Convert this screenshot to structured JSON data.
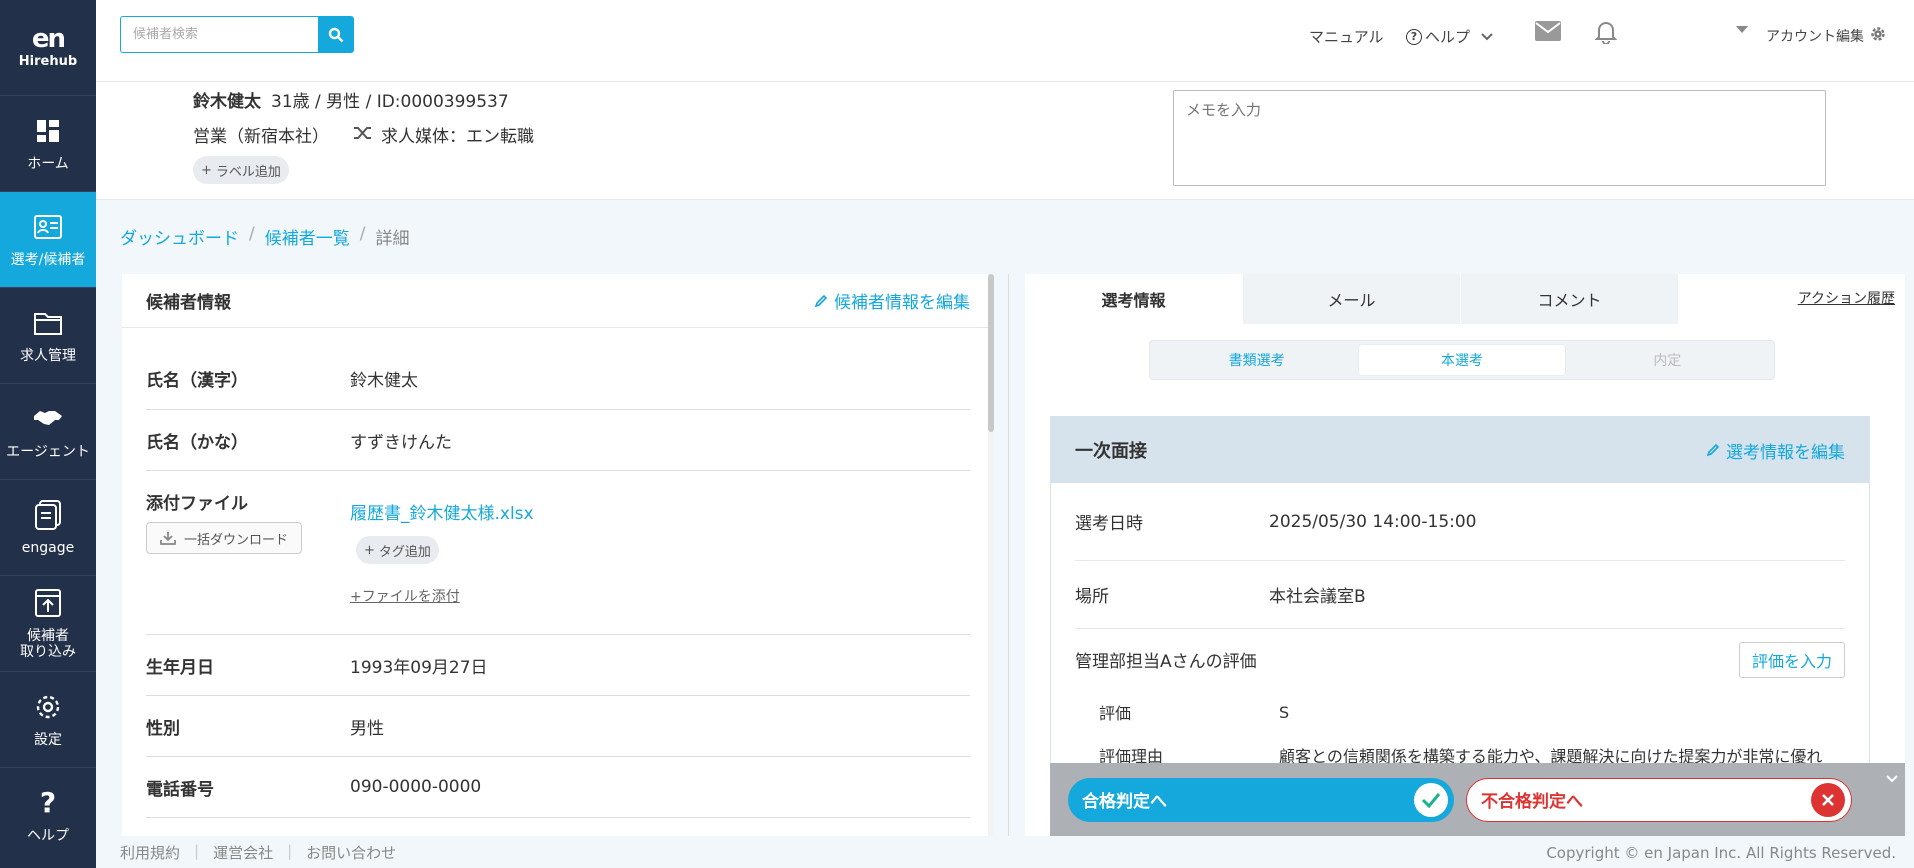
{
  "sidebar": {
    "logo_mark": "en",
    "logo_text": "Hirehub",
    "items": [
      {
        "label": "ホーム",
        "icon": "dashboard-icon"
      },
      {
        "label": "選考/候補者",
        "icon": "id-card-icon"
      },
      {
        "label": "求人管理",
        "icon": "folder-icon"
      },
      {
        "label": "エージェント",
        "icon": "handshake-icon"
      },
      {
        "label": "engage",
        "icon": "engage-icon"
      },
      {
        "label1": "候補者",
        "label2": "取り込み",
        "icon": "import-icon"
      },
      {
        "label": "設定",
        "icon": "gear-icon"
      },
      {
        "label": "ヘルプ",
        "icon": "question-icon"
      }
    ]
  },
  "header": {
    "search_placeholder": "候補者検索",
    "manual": "マニュアル",
    "help": "ヘルプ",
    "account": "アカウント編集"
  },
  "profile": {
    "name": "鈴木健太",
    "meta": "31歳 / 男性 / ID:0000399537",
    "dept": "営業（新宿本社）",
    "media": "求人媒体：エン転職",
    "add_label": "ラベル追加",
    "memo_placeholder": "メモを入力"
  },
  "breadcrumb": {
    "dashboard": "ダッシュボード",
    "list": "候補者一覧",
    "current": "詳細"
  },
  "candidate": {
    "title": "候補者情報",
    "edit": "候補者情報を編集",
    "name_kanji_label": "氏名（漢字）",
    "name_kanji": "鈴木健太",
    "name_kana_label": "氏名（かな）",
    "name_kana": "すずきけんた",
    "files_label": "添付ファイル",
    "bulk_download": "一括ダウンロード",
    "file_name": "履歴書_鈴木健太様.xlsx",
    "add_tag": "タグ追加",
    "attach_file": "+ファイルを添付",
    "birth_label": "生年月日",
    "birth": "1993年09月27日",
    "gender_label": "性別",
    "gender": "男性",
    "phone_label": "電話番号",
    "phone": "090-0000-0000"
  },
  "selection": {
    "tabs": [
      "選考情報",
      "メール",
      "コメント"
    ],
    "action_history": "アクション履歴",
    "stages": [
      "書類選考",
      "本選考",
      "内定"
    ],
    "card_title": "一次面接",
    "edit": "選考情報を編集",
    "date_label": "選考日時",
    "date": "2025/05/30 14:00-15:00",
    "place_label": "場所",
    "place": "本社会議室B",
    "eval_title": "管理部担当Aさんの評価",
    "eval_button": "評価を入力",
    "rating_label": "評価",
    "rating": "S",
    "reason_label": "評価理由",
    "reason": "顧客との信頼関係を構築する能力や、課題解決に向けた提案力が非常に優れ",
    "pass": "合格判定へ",
    "fail": "不合格判定へ"
  },
  "footer": {
    "terms": "利用規約",
    "company": "運営会社",
    "contact": "お問い合わせ",
    "copyright": "Copyright © en Japan Inc. All Rights Reserved."
  },
  "colors": {
    "accent": "#14a8dc",
    "sidebar": "#22304a",
    "danger": "#dd3333"
  }
}
